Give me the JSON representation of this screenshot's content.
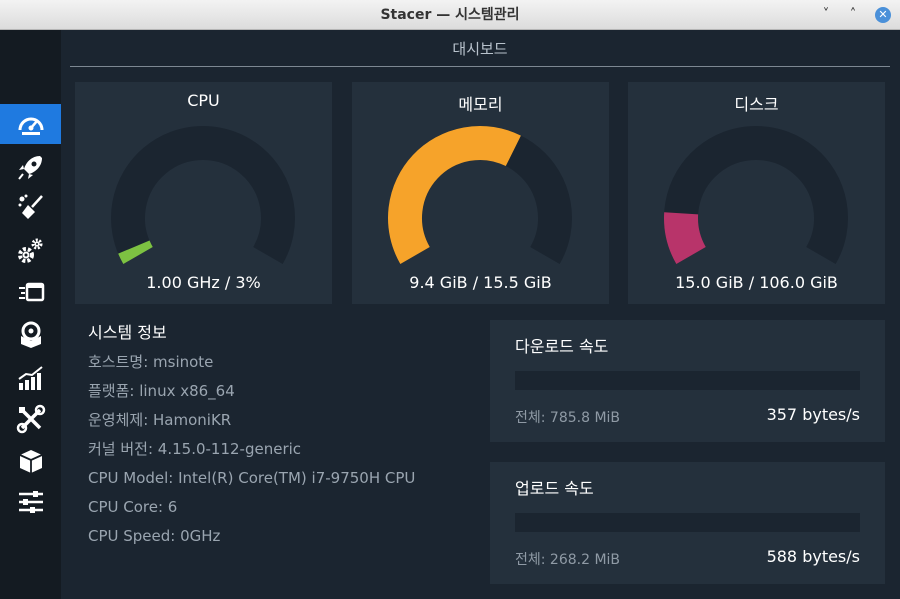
{
  "window": {
    "title": "Stacer — 시스템관리",
    "minimize": "˅",
    "maximize": "˄",
    "close": "✕"
  },
  "sidebar": {
    "items": [
      {
        "icon": "dashboard-gauge-icon",
        "active": true
      },
      {
        "icon": "rocket-icon",
        "active": false
      },
      {
        "icon": "broom-cleaner-icon",
        "active": false
      },
      {
        "icon": "gears-services-icon",
        "active": false
      },
      {
        "icon": "processes-window-icon",
        "active": false
      },
      {
        "icon": "uninstaller-disk-icon",
        "active": false
      },
      {
        "icon": "resources-chart-icon",
        "active": false
      },
      {
        "icon": "tools-wrench-icon",
        "active": false
      },
      {
        "icon": "package-box-icon",
        "active": false
      },
      {
        "icon": "settings-sliders-icon",
        "active": false
      }
    ]
  },
  "dashboard": {
    "title": "대시보드",
    "cpu": {
      "label": "CPU",
      "value": "1.00 GHz / 3%",
      "percent": 3,
      "color": "#7dc242"
    },
    "memory": {
      "label": "메모리",
      "value": "9.4 GiB / 15.5 GiB",
      "percent": 61,
      "color": "#f6a32a"
    },
    "disk": {
      "label": "디스크",
      "value": "15.0 GiB / 106.0 GiB",
      "percent": 14,
      "color": "#b8346a"
    },
    "gauge_track_color": "#1b2530",
    "system_info": {
      "title": "시스템 정보",
      "rows": [
        "호스트명: msinote",
        "플랫폼: linux x86_64",
        "운영체제: HamoniKR",
        "커널 버전: 4.15.0-112-generic",
        "CPU Model: Intel(R) Core(TM) i7-9750H CPU",
        "CPU Core: 6",
        "CPU Speed: 0GHz"
      ]
    },
    "download": {
      "title": "다운로드 속도",
      "total": "전체: 785.8 MiB",
      "speed": "357 bytes/s"
    },
    "upload": {
      "title": "업로드 속도",
      "total": "전체: 268.2 MiB",
      "speed": "588 bytes/s"
    }
  }
}
